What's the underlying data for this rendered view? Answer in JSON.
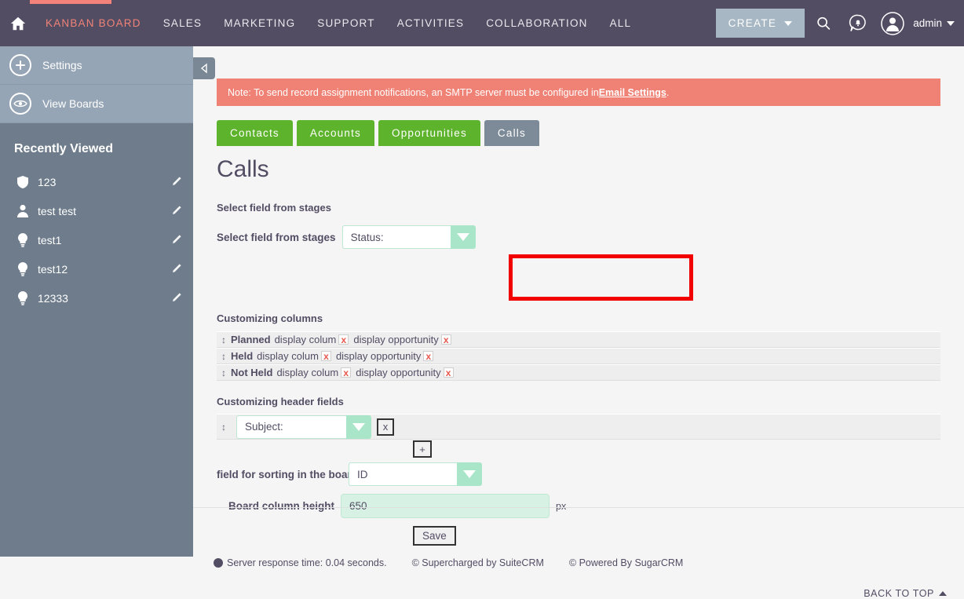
{
  "topnav": {
    "home_icon": "home-icon",
    "items": [
      {
        "label": "KANBAN BOARD",
        "active": true
      },
      {
        "label": "SALES",
        "active": false
      },
      {
        "label": "MARKETING",
        "active": false
      },
      {
        "label": "SUPPORT",
        "active": false
      },
      {
        "label": "ACTIVITIES",
        "active": false
      },
      {
        "label": "COLLABORATION",
        "active": false
      },
      {
        "label": "ALL",
        "active": false
      }
    ],
    "create_label": "CREATE",
    "search_icon": "search-icon",
    "notifications_icon": "notification-bell-icon",
    "avatar_icon": "user-avatar-icon",
    "user_label": "admin",
    "accent_color": "#f3837a",
    "bg_color": "#534d64"
  },
  "sidebar": {
    "actions": [
      {
        "label": "Settings",
        "icon": "plus-circle-icon"
      },
      {
        "label": "View Boards",
        "icon": "eye-circle-icon"
      }
    ],
    "recently_viewed_title": "Recently Viewed",
    "recent_items": [
      {
        "label": "123",
        "icon": "shield-icon",
        "edit_icon": "pencil-icon"
      },
      {
        "label": "test test",
        "icon": "person-icon",
        "edit_icon": "pencil-icon"
      },
      {
        "label": "test1",
        "icon": "lightbulb-icon",
        "edit_icon": "pencil-icon"
      },
      {
        "label": "test12",
        "icon": "lightbulb-icon",
        "edit_icon": "pencil-icon"
      },
      {
        "label": "12333",
        "icon": "lightbulb-icon",
        "edit_icon": "pencil-icon"
      }
    ]
  },
  "main": {
    "collapse_icon": "collapse-left-icon",
    "banner": {
      "text_before": "Note: To send record assignment notifications, an SMTP server must be configured in ",
      "link_text": "Email Settings",
      "text_after": ".",
      "bg_color": "#ef8175"
    },
    "tabs": [
      {
        "label": "Contacts",
        "active": false
      },
      {
        "label": "Accounts",
        "active": false
      },
      {
        "label": "Opportunities",
        "active": false
      },
      {
        "label": "Calls",
        "active": true
      }
    ],
    "page_title": "Calls",
    "stages": {
      "section_label": "Select field from stages",
      "inline_label": "Select field from stages",
      "selected_value": "Status:",
      "highlight_color": "#f20000"
    },
    "columns": {
      "section_label": "Customizing columns",
      "rows": [
        {
          "name": "Planned",
          "text1": "display colum",
          "x1": "x",
          "text2": "display opportunity",
          "x2": "x",
          "handle": "drag-handle-icon"
        },
        {
          "name": "Held",
          "text1": "display colum",
          "x1": "x",
          "text2": "display opportunity",
          "x2": "x",
          "handle": "drag-handle-icon"
        },
        {
          "name": "Not Held",
          "text1": "display colum",
          "x1": "x",
          "text2": "display opportunity",
          "x2": "x",
          "handle": "drag-handle-icon"
        }
      ]
    },
    "header_fields": {
      "section_label": "Customizing header fields",
      "row": {
        "selected_value": "Subject:",
        "remove_label": "x",
        "handle": "drag-handle-icon"
      },
      "add_label": "+"
    },
    "sort": {
      "label": "field for sorting in the board",
      "selected_value": "ID"
    },
    "height": {
      "label": "Board column height",
      "value": "650",
      "unit": "px"
    },
    "save_label": "Save"
  },
  "footer": {
    "response_time": "Server response time: 0.04 seconds.",
    "supercharged": "© Supercharged by SuiteCRM",
    "powered": "© Powered By SugarCRM",
    "back_to_top": "BACK TO TOP"
  }
}
